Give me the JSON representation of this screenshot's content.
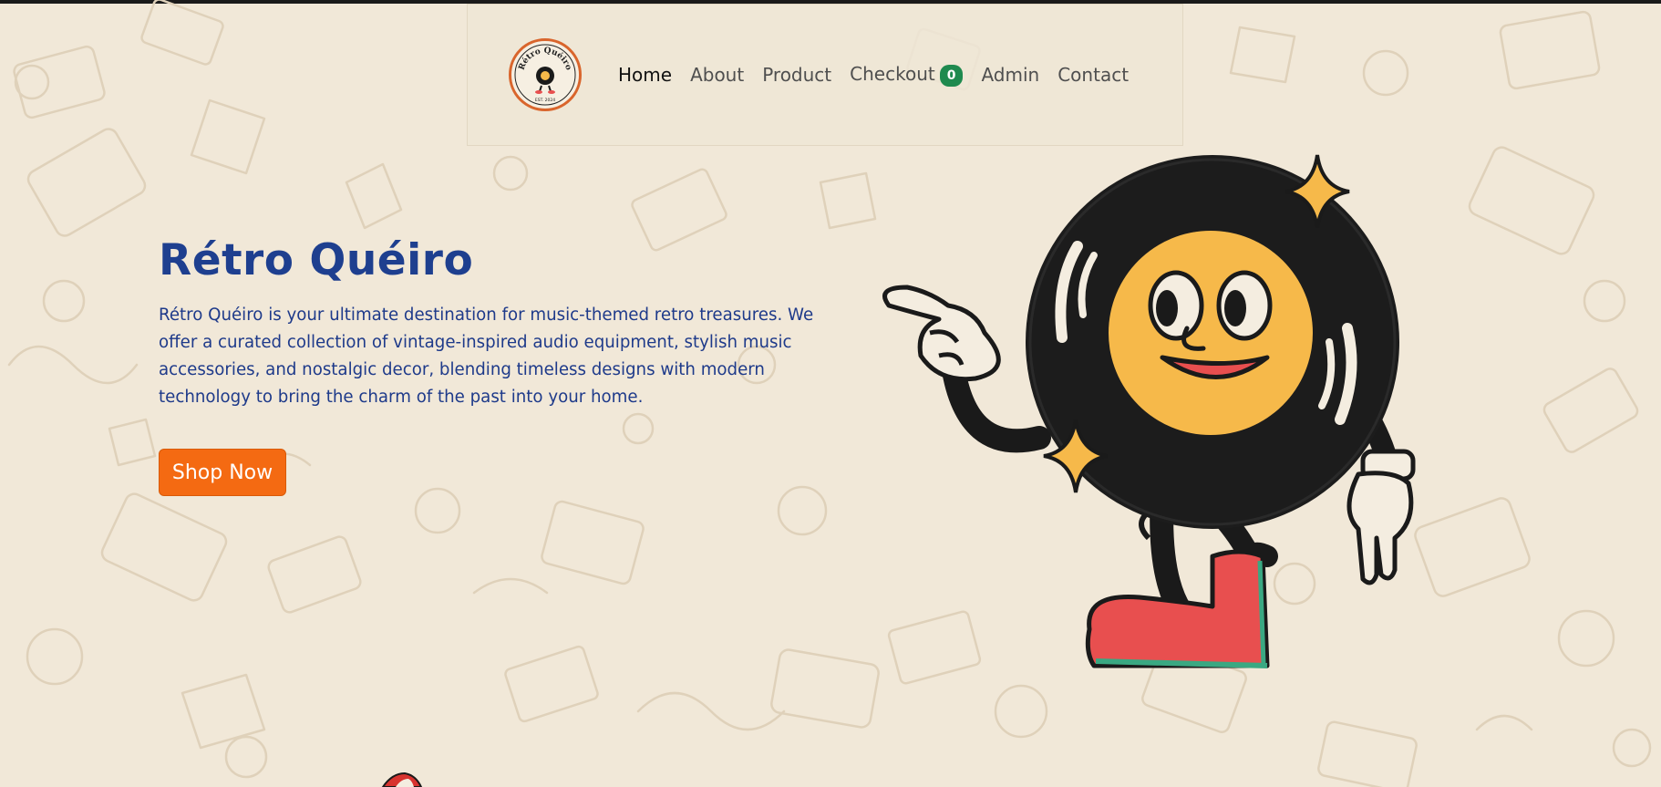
{
  "brand": {
    "logo_text": "Rétro Quéiro",
    "logo_est": "EST. 2024"
  },
  "nav": {
    "items": [
      {
        "label": "Home",
        "active": true
      },
      {
        "label": "About"
      },
      {
        "label": "Product"
      },
      {
        "label": "Checkout",
        "badge": "0"
      },
      {
        "label": "Admin"
      },
      {
        "label": "Contact"
      }
    ]
  },
  "hero": {
    "title": "Rétro Quéiro",
    "description": "Rétro Quéiro is your ultimate destination for music-themed retro treasures. We offer a curated collection of vintage-inspired audio equipment, stylish music accessories, and nostalgic decor, blending timeless designs with modern technology to bring the charm of the past into your home.",
    "cta_label": "Shop Now",
    "illustration": "vinyl-record-mascot"
  },
  "colors": {
    "background": "#f1e8d8",
    "title": "#1e3f8f",
    "accent": "#f46a12",
    "badge": "#1f8a4f",
    "logo_ring": "#d9652c"
  },
  "icons": {
    "background_pattern": "retro-doodle-pattern",
    "cart_badge": "count-badge"
  }
}
